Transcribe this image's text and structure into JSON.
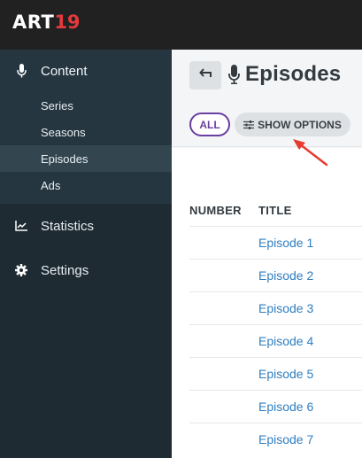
{
  "app": {
    "logo_text": "ART",
    "logo_mark": "19"
  },
  "sidebar": {
    "content_label": "Content",
    "sub_items": [
      {
        "label": "Series",
        "active": false
      },
      {
        "label": "Seasons",
        "active": false
      },
      {
        "label": "Episodes",
        "active": true
      },
      {
        "label": "Ads",
        "active": false
      }
    ],
    "statistics_label": "Statistics",
    "settings_label": "Settings"
  },
  "header": {
    "title": "Episodes",
    "filter_all": "ALL",
    "show_options": "SHOW OPTIONS"
  },
  "table": {
    "columns": [
      "NUMBER",
      "TITLE"
    ],
    "rows": [
      {
        "number": "",
        "title": "Episode 1"
      },
      {
        "number": "",
        "title": "Episode 2"
      },
      {
        "number": "",
        "title": "Episode 3"
      },
      {
        "number": "",
        "title": "Episode 4"
      },
      {
        "number": "",
        "title": "Episode 5"
      },
      {
        "number": "",
        "title": "Episode 6"
      },
      {
        "number": "",
        "title": "Episode 7"
      }
    ]
  },
  "colors": {
    "accent_purple": "#6a3fa1",
    "link_blue": "#2e7ec1",
    "brand_red": "#e4393c",
    "annotation_red": "#e63b2e"
  },
  "icons": [
    "microphone-icon",
    "line-chart-icon",
    "gear-icon",
    "back-arrow-icon",
    "sliders-icon",
    "annotation-arrow"
  ]
}
